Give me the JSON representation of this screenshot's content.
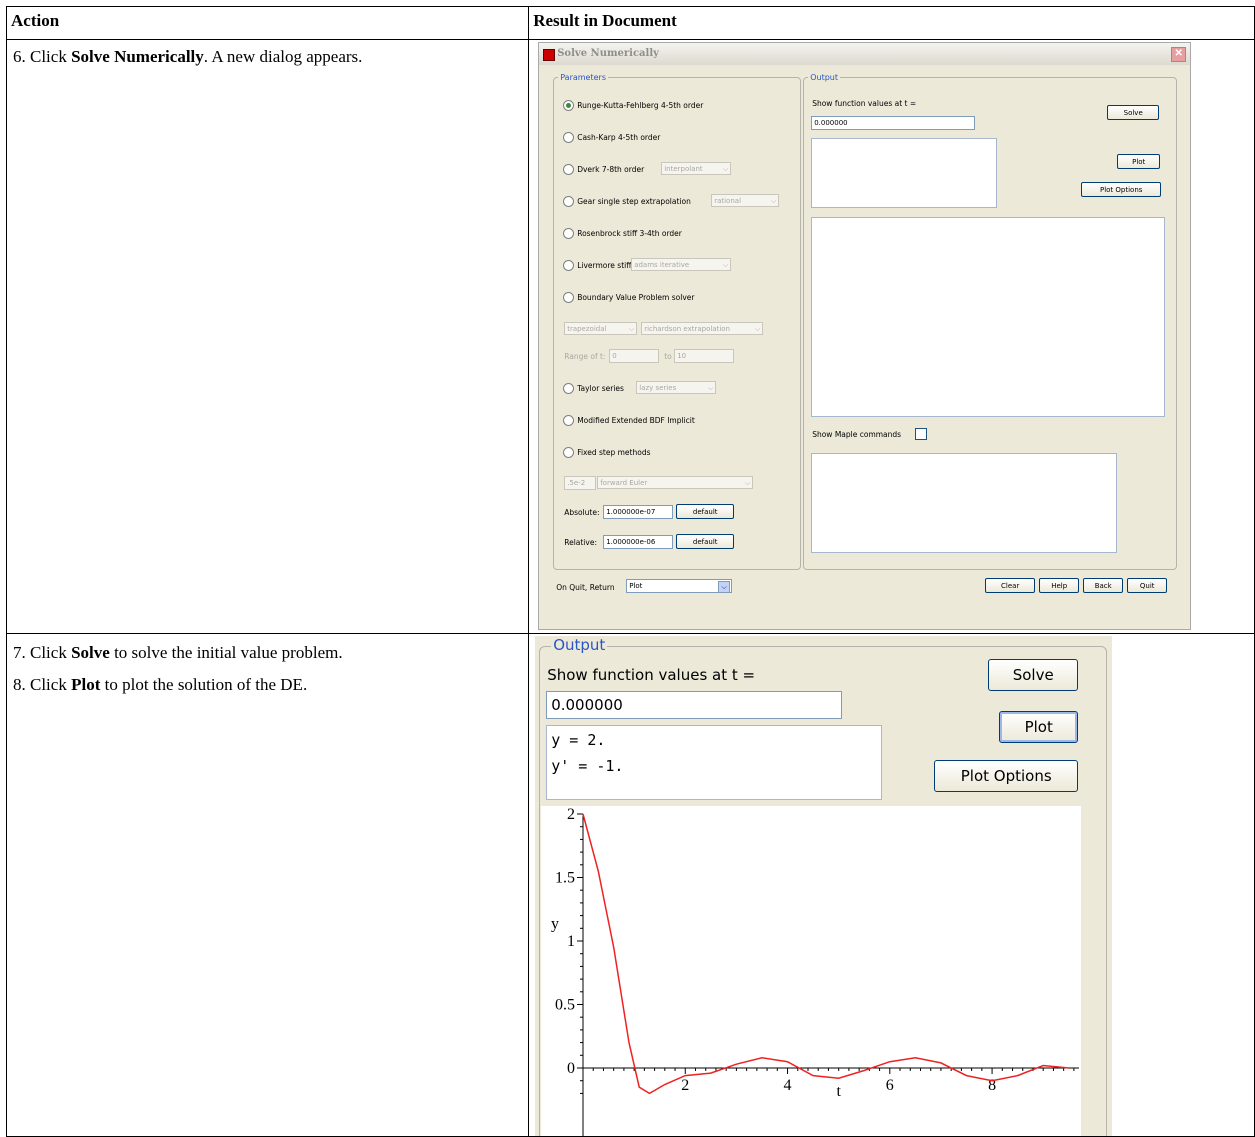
{
  "table": {
    "header_action": "Action",
    "header_result": "Result in Document"
  },
  "steps": {
    "s6_num": "6.",
    "s6_pre": " Click ",
    "s6_bold": "Solve Numerically",
    "s6_post": ". A new dialog appears.",
    "s7_num": "7.",
    "s7_pre": " Click ",
    "s7_bold": "Solve",
    "s7_post": " to solve the initial value problem.",
    "s8_num": "8.",
    "s8_pre": " Click ",
    "s8_bold": "Plot",
    "s8_post": " to plot the solution of the DE."
  },
  "dialog": {
    "title": "Solve Numerically",
    "params_legend": "Parameters",
    "output_legend": "Output",
    "methods": {
      "rkf": "Runge-Kutta-Fehlberg 4-5th order",
      "ck": "Cash-Karp 4-5th order",
      "dverk": "Dverk 7-8th order",
      "gear": "Gear single step extrapolation",
      "rosen": "Rosenbrock stiff 3-4th order",
      "liver": "Livermore stiff",
      "bvp": "Boundary Value Problem solver",
      "taylor": "Taylor series",
      "mebdf": "Modified Extended BDF Implicit",
      "fixed": "Fixed step methods"
    },
    "dverk_opt": "interpolant",
    "gear_opt": "rational",
    "liver_opt": "adams iterative",
    "bvp_opt1": "trapezoidal",
    "bvp_opt2": "richardson extrapolation",
    "range_label": "Range of t:",
    "range_from": "0",
    "range_to_label": "to",
    "range_to": "10",
    "taylor_opt": "lazy series",
    "fixed_step": ".5e-2",
    "fixed_opt": "forward Euler",
    "absolute_label": "Absolute:",
    "absolute_val": "1.000000e-07",
    "relative_label": "Relative:",
    "relative_val": "1.000000e-06",
    "default_btn": "default",
    "show_values_label": "Show function values at t =",
    "t_value": "0.000000",
    "solve_btn": "Solve",
    "plot_btn": "Plot",
    "plot_options_btn": "Plot Options",
    "show_maple": "Show Maple commands",
    "on_quit_label": "On Quit, Return",
    "on_quit_val": "Plot",
    "clear_btn": "Clear",
    "help_btn": "Help",
    "back_btn": "Back",
    "quit_btn": "Quit"
  },
  "zoom": {
    "legend": "Output",
    "show_values_label": "Show function values at t =",
    "t_value": "0.000000",
    "result_line1": "y = 2.",
    "result_line2": "y' = -1.",
    "solve_btn": "Solve",
    "plot_btn": "Plot",
    "plot_options_btn": "Plot Options"
  },
  "chart_data": {
    "type": "line",
    "title": "",
    "xlabel": "t",
    "ylabel": "y",
    "xlim": [
      0,
      10
    ],
    "ylim": [
      -0.2,
      2.0
    ],
    "xticks": [
      "2",
      "4",
      "6",
      "8"
    ],
    "yticks": [
      "0",
      "0.5",
      "1",
      "1.5",
      "2"
    ],
    "series": [
      {
        "color": "#ee2222",
        "x": [
          0,
          0.3,
          0.6,
          0.9,
          1.1,
          1.3,
          1.6,
          2.0,
          2.5,
          3.0,
          3.5,
          4.0,
          4.5,
          5.0,
          5.5,
          6.0,
          6.5,
          7.0,
          7.5,
          8.0,
          8.5,
          9.0,
          9.5
        ],
        "y": [
          2.0,
          1.55,
          0.95,
          0.2,
          -0.15,
          -0.2,
          -0.13,
          -0.06,
          -0.04,
          0.03,
          0.08,
          0.05,
          -0.06,
          -0.08,
          -0.02,
          0.05,
          0.08,
          0.04,
          -0.06,
          -0.1,
          -0.06,
          0.02,
          0.0
        ]
      }
    ]
  }
}
